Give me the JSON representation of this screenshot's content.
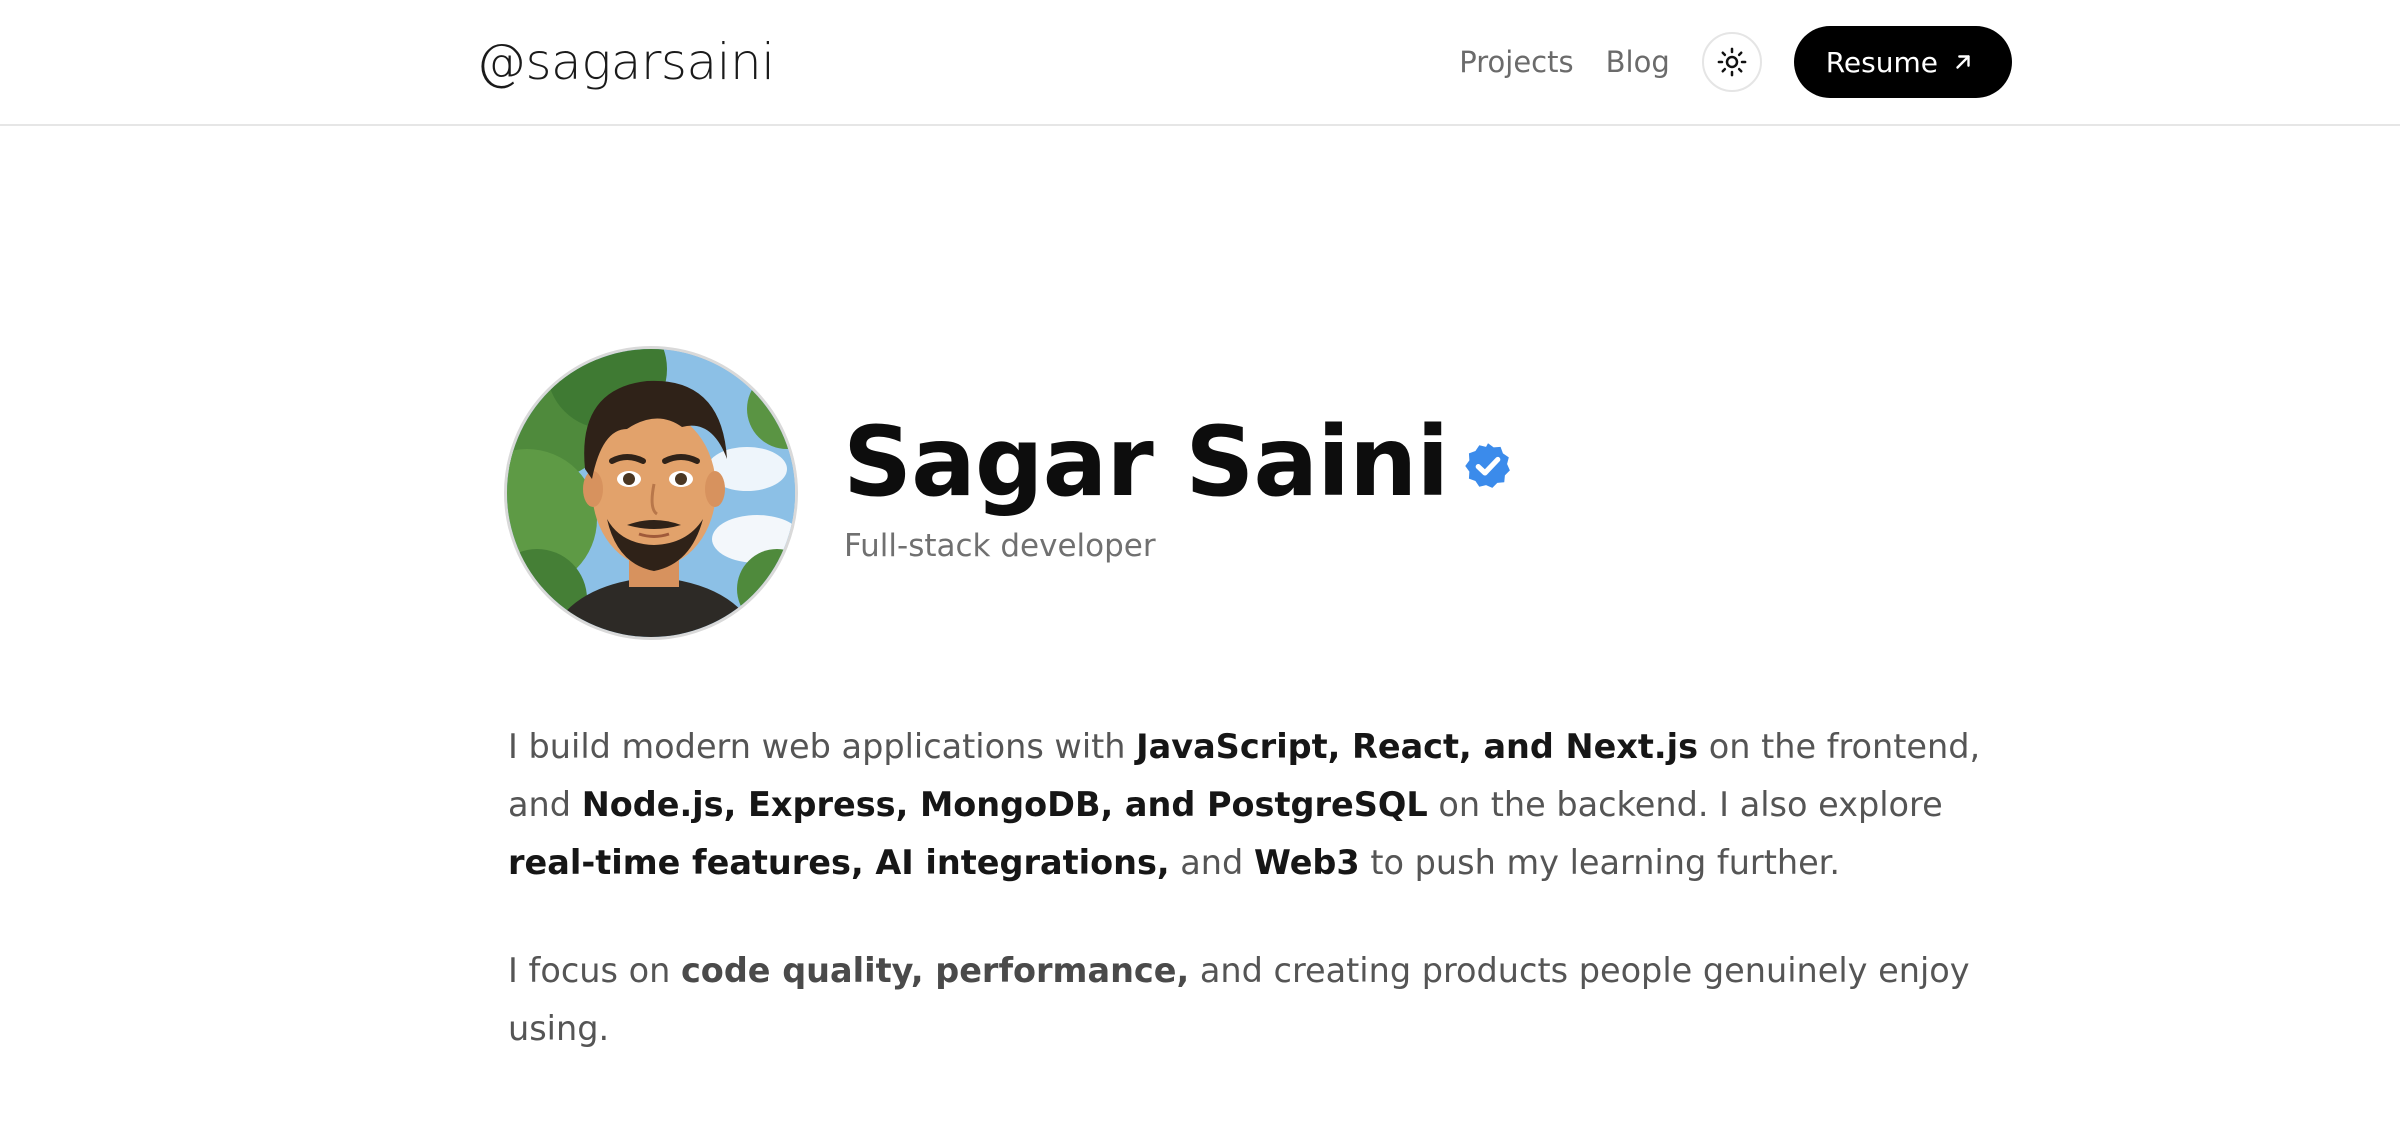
{
  "header": {
    "brand": "@sagarsaini",
    "nav": [
      {
        "label": "Projects"
      },
      {
        "label": "Blog"
      }
    ],
    "theme_toggle_icon": "sun-icon",
    "resume_label": "Resume",
    "resume_icon": "arrow-up-right-icon"
  },
  "profile": {
    "name": "Sagar Saini",
    "verified_icon": "verified-badge-icon",
    "verified_color": "#3b8beb",
    "role": "Full-stack developer"
  },
  "bio": {
    "p1": [
      {
        "t": "I build modern web applications with ",
        "b": false
      },
      {
        "t": "JavaScript, React, and Next.js",
        "b": true
      },
      {
        "t": " on the frontend, and ",
        "b": false
      },
      {
        "t": "Node.js, Express, MongoDB, and PostgreSQL",
        "b": true
      },
      {
        "t": " on the backend. I also explore ",
        "b": false
      },
      {
        "t": "real-time features, AI integrations,",
        "b": true
      },
      {
        "t": " and ",
        "b": false
      },
      {
        "t": "Web3",
        "b": true
      },
      {
        "t": " to push my learning further.",
        "b": false
      }
    ],
    "p2": [
      {
        "t": "I focus on ",
        "b": false
      },
      {
        "t": "code quality, performance,",
        "b": true
      },
      {
        "t": " and creating products people genuinely enjoy using.",
        "b": false
      }
    ]
  }
}
